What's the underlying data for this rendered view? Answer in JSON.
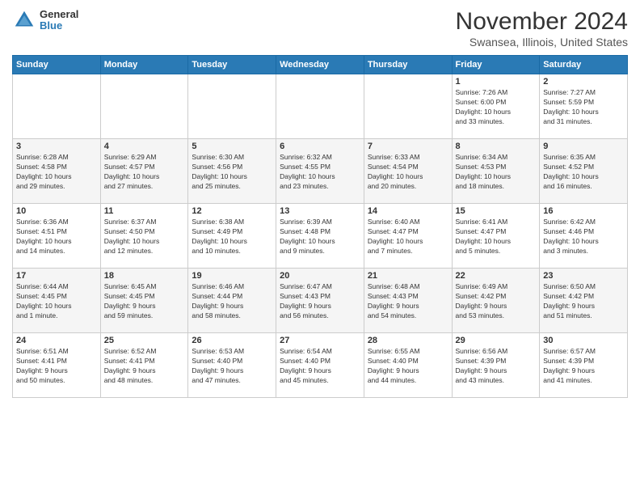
{
  "logo": {
    "line1": "General",
    "line2": "Blue"
  },
  "header": {
    "title": "November 2024",
    "location": "Swansea, Illinois, United States"
  },
  "weekdays": [
    "Sunday",
    "Monday",
    "Tuesday",
    "Wednesday",
    "Thursday",
    "Friday",
    "Saturday"
  ],
  "weeks": [
    [
      {
        "day": "",
        "info": ""
      },
      {
        "day": "",
        "info": ""
      },
      {
        "day": "",
        "info": ""
      },
      {
        "day": "",
        "info": ""
      },
      {
        "day": "",
        "info": ""
      },
      {
        "day": "1",
        "info": "Sunrise: 7:26 AM\nSunset: 6:00 PM\nDaylight: 10 hours\nand 33 minutes."
      },
      {
        "day": "2",
        "info": "Sunrise: 7:27 AM\nSunset: 5:59 PM\nDaylight: 10 hours\nand 31 minutes."
      }
    ],
    [
      {
        "day": "3",
        "info": "Sunrise: 6:28 AM\nSunset: 4:58 PM\nDaylight: 10 hours\nand 29 minutes."
      },
      {
        "day": "4",
        "info": "Sunrise: 6:29 AM\nSunset: 4:57 PM\nDaylight: 10 hours\nand 27 minutes."
      },
      {
        "day": "5",
        "info": "Sunrise: 6:30 AM\nSunset: 4:56 PM\nDaylight: 10 hours\nand 25 minutes."
      },
      {
        "day": "6",
        "info": "Sunrise: 6:32 AM\nSunset: 4:55 PM\nDaylight: 10 hours\nand 23 minutes."
      },
      {
        "day": "7",
        "info": "Sunrise: 6:33 AM\nSunset: 4:54 PM\nDaylight: 10 hours\nand 20 minutes."
      },
      {
        "day": "8",
        "info": "Sunrise: 6:34 AM\nSunset: 4:53 PM\nDaylight: 10 hours\nand 18 minutes."
      },
      {
        "day": "9",
        "info": "Sunrise: 6:35 AM\nSunset: 4:52 PM\nDaylight: 10 hours\nand 16 minutes."
      }
    ],
    [
      {
        "day": "10",
        "info": "Sunrise: 6:36 AM\nSunset: 4:51 PM\nDaylight: 10 hours\nand 14 minutes."
      },
      {
        "day": "11",
        "info": "Sunrise: 6:37 AM\nSunset: 4:50 PM\nDaylight: 10 hours\nand 12 minutes."
      },
      {
        "day": "12",
        "info": "Sunrise: 6:38 AM\nSunset: 4:49 PM\nDaylight: 10 hours\nand 10 minutes."
      },
      {
        "day": "13",
        "info": "Sunrise: 6:39 AM\nSunset: 4:48 PM\nDaylight: 10 hours\nand 9 minutes."
      },
      {
        "day": "14",
        "info": "Sunrise: 6:40 AM\nSunset: 4:47 PM\nDaylight: 10 hours\nand 7 minutes."
      },
      {
        "day": "15",
        "info": "Sunrise: 6:41 AM\nSunset: 4:47 PM\nDaylight: 10 hours\nand 5 minutes."
      },
      {
        "day": "16",
        "info": "Sunrise: 6:42 AM\nSunset: 4:46 PM\nDaylight: 10 hours\nand 3 minutes."
      }
    ],
    [
      {
        "day": "17",
        "info": "Sunrise: 6:44 AM\nSunset: 4:45 PM\nDaylight: 10 hours\nand 1 minute."
      },
      {
        "day": "18",
        "info": "Sunrise: 6:45 AM\nSunset: 4:45 PM\nDaylight: 9 hours\nand 59 minutes."
      },
      {
        "day": "19",
        "info": "Sunrise: 6:46 AM\nSunset: 4:44 PM\nDaylight: 9 hours\nand 58 minutes."
      },
      {
        "day": "20",
        "info": "Sunrise: 6:47 AM\nSunset: 4:43 PM\nDaylight: 9 hours\nand 56 minutes."
      },
      {
        "day": "21",
        "info": "Sunrise: 6:48 AM\nSunset: 4:43 PM\nDaylight: 9 hours\nand 54 minutes."
      },
      {
        "day": "22",
        "info": "Sunrise: 6:49 AM\nSunset: 4:42 PM\nDaylight: 9 hours\nand 53 minutes."
      },
      {
        "day": "23",
        "info": "Sunrise: 6:50 AM\nSunset: 4:42 PM\nDaylight: 9 hours\nand 51 minutes."
      }
    ],
    [
      {
        "day": "24",
        "info": "Sunrise: 6:51 AM\nSunset: 4:41 PM\nDaylight: 9 hours\nand 50 minutes."
      },
      {
        "day": "25",
        "info": "Sunrise: 6:52 AM\nSunset: 4:41 PM\nDaylight: 9 hours\nand 48 minutes."
      },
      {
        "day": "26",
        "info": "Sunrise: 6:53 AM\nSunset: 4:40 PM\nDaylight: 9 hours\nand 47 minutes."
      },
      {
        "day": "27",
        "info": "Sunrise: 6:54 AM\nSunset: 4:40 PM\nDaylight: 9 hours\nand 45 minutes."
      },
      {
        "day": "28",
        "info": "Sunrise: 6:55 AM\nSunset: 4:40 PM\nDaylight: 9 hours\nand 44 minutes."
      },
      {
        "day": "29",
        "info": "Sunrise: 6:56 AM\nSunset: 4:39 PM\nDaylight: 9 hours\nand 43 minutes."
      },
      {
        "day": "30",
        "info": "Sunrise: 6:57 AM\nSunset: 4:39 PM\nDaylight: 9 hours\nand 41 minutes."
      }
    ]
  ]
}
